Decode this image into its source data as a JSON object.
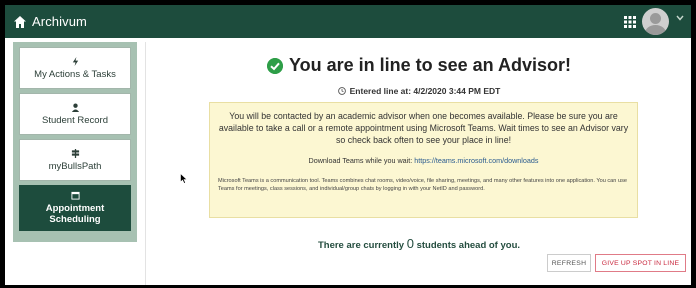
{
  "app": {
    "title": "Archivum"
  },
  "sidebar": {
    "items": [
      {
        "label": "My Actions & Tasks",
        "icon": "bolt-icon",
        "active": false
      },
      {
        "label": "Student Record",
        "icon": "user-icon",
        "active": false
      },
      {
        "label": "myBullsPath",
        "icon": "signpost-icon",
        "active": false
      },
      {
        "label": "Appointment Scheduling",
        "icon": "calendar-icon",
        "active": true
      }
    ]
  },
  "main": {
    "headline": "You are in line to see an Advisor!",
    "entered_line": "Entered line at: 4/2/2020 3:44 PM EDT",
    "notice": {
      "paragraph": "You will be contacted by an academic advisor when one becomes available. Please be sure you are available to take a call or a remote appointment using Microsoft Teams. Wait times to see an Advisor vary so check back often to see your place in line!",
      "download_prefix": "Download Teams while you wait:",
      "download_link": "https://teams.microsoft.com/downloads",
      "small_print": "Microsoft Teams is a communication tool. Teams combines chat rooms, video/voice, file sharing, meetings, and many other features into one application. You can use Teams for meetings, class sessions, and individual/group chats by logging in with your NetID and password."
    },
    "queue": {
      "prefix": "There are currently",
      "count": "0",
      "suffix": "students ahead of you."
    },
    "buttons": {
      "refresh": "REFRESH",
      "give_up": "GIVE UP SPOT IN LINE"
    }
  },
  "colors": {
    "brand_green": "#1d4c3d",
    "sidebar_bg": "#a7c1b2",
    "notice_bg": "#fcf7d2",
    "success": "#2e9e48",
    "danger": "#c9283e"
  }
}
